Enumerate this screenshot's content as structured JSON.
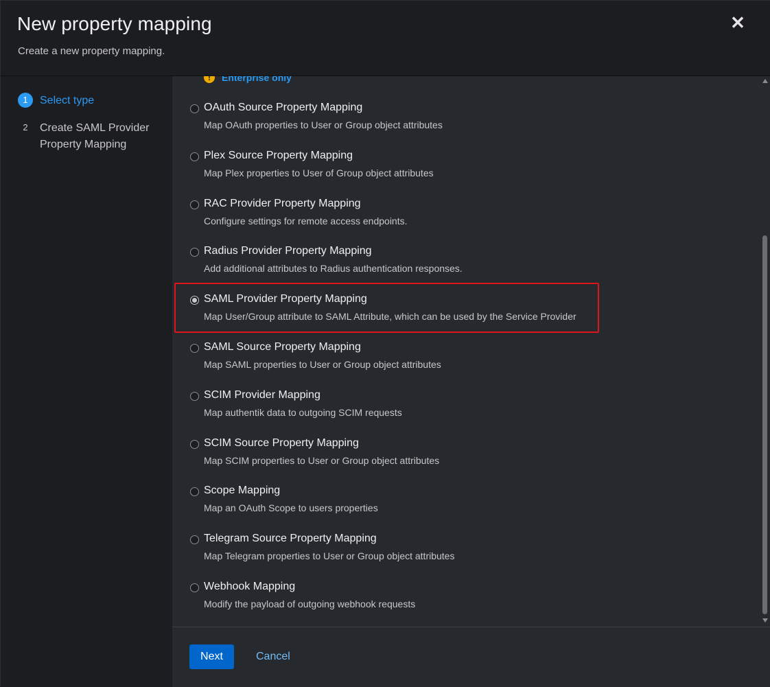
{
  "header": {
    "title": "New property mapping",
    "subtitle": "Create a new property mapping.",
    "close_icon": "close-icon"
  },
  "wizard_nav": {
    "steps": [
      {
        "number": "1",
        "label": "Select type",
        "state": "current"
      },
      {
        "number": "2",
        "label": "Create SAML Provider Property Mapping",
        "state": "pending"
      }
    ]
  },
  "content": {
    "enterprise_badge": {
      "icon": "warning-icon",
      "label": "Enterprise only"
    },
    "options": [
      {
        "label": "OAuth Source Property Mapping",
        "description": "Map OAuth properties to User or Group object attributes",
        "checked": false
      },
      {
        "label": "Plex Source Property Mapping",
        "description": "Map Plex properties to User of Group object attributes",
        "checked": false
      },
      {
        "label": "RAC Provider Property Mapping",
        "description": "Configure settings for remote access endpoints.",
        "checked": false
      },
      {
        "label": "Radius Provider Property Mapping",
        "description": "Add additional attributes to Radius authentication responses.",
        "checked": false
      },
      {
        "label": "SAML Provider Property Mapping",
        "description": "Map User/Group attribute to SAML Attribute, which can be used by the Service Provider",
        "checked": true
      },
      {
        "label": "SAML Source Property Mapping",
        "description": "Map SAML properties to User or Group object attributes",
        "checked": false
      },
      {
        "label": "SCIM Provider Mapping",
        "description": "Map authentik data to outgoing SCIM requests",
        "checked": false
      },
      {
        "label": "SCIM Source Property Mapping",
        "description": "Map SCIM properties to User or Group object attributes",
        "checked": false
      },
      {
        "label": "Scope Mapping",
        "description": "Map an OAuth Scope to users properties",
        "checked": false
      },
      {
        "label": "Telegram Source Property Mapping",
        "description": "Map Telegram properties to User or Group object attributes",
        "checked": false
      },
      {
        "label": "Webhook Mapping",
        "description": "Modify the payload of outgoing webhook requests",
        "checked": false
      }
    ]
  },
  "footer": {
    "next_label": "Next",
    "cancel_label": "Cancel"
  },
  "colors": {
    "accent": "#2b9af3",
    "primary_button": "#0066cc",
    "highlight_box": "#e0151b",
    "enterprise_icon": "#f0ab00"
  }
}
